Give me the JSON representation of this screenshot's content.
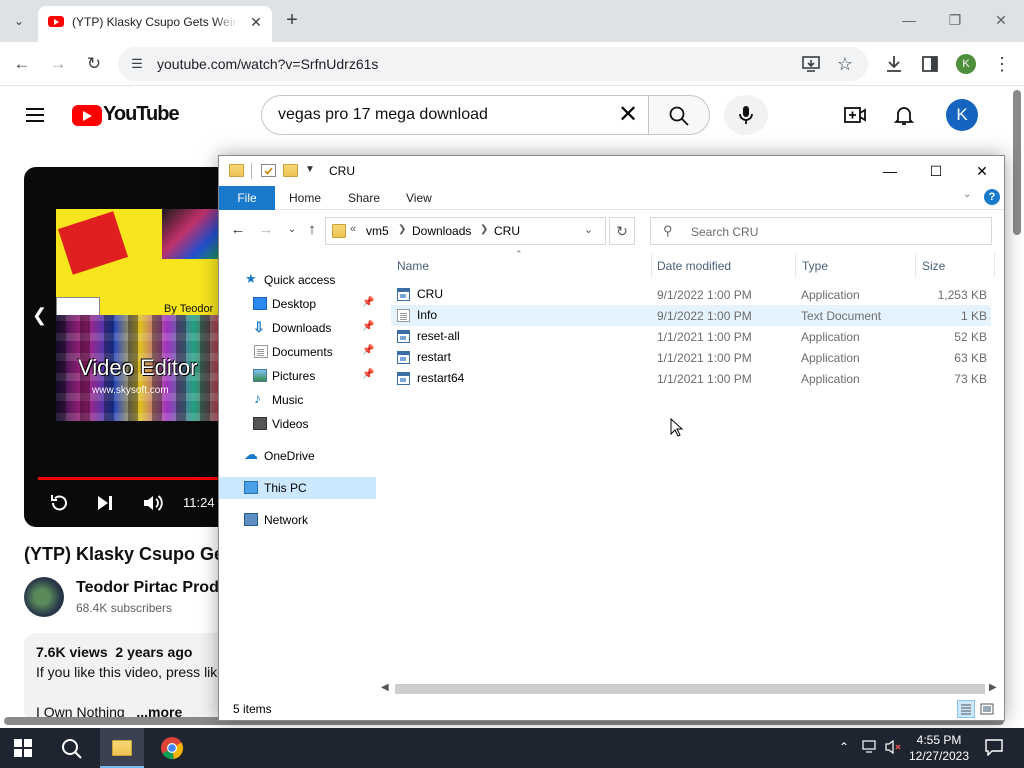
{
  "browser": {
    "tab_title": "(YTP) Klasky Csupo Gets Weirder",
    "url": "youtube.com/watch?v=SrfnUdrz61s"
  },
  "youtube": {
    "search_query": "vegas pro 17 mega download",
    "avatar_letter": "K",
    "video_time": "11:24",
    "video_title": "(YTP) Klasky Csupo Gets Weirder",
    "channel_name": "Teodor Pirtac Productions",
    "subscribers": "68.4K subscribers",
    "views": "7.6K views",
    "age": "2 years ago",
    "description": "If you like this video, press like",
    "description_line2": "I Own Nothing",
    "more_label": "...more",
    "thumb_text_top": "By Teodor",
    "thumb_text_main": "Video Editor",
    "thumb_text_site": "www.skysoft.com"
  },
  "explorer": {
    "title": "CRU",
    "ribbon": {
      "file": "File",
      "home": "Home",
      "share": "Share",
      "view": "View"
    },
    "breadcrumb": [
      "vm5",
      "Downloads",
      "CRU"
    ],
    "search_placeholder": "Search CRU",
    "nav": {
      "quick_access": "Quick access",
      "desktop": "Desktop",
      "downloads": "Downloads",
      "documents": "Documents",
      "pictures": "Pictures",
      "music": "Music",
      "videos": "Videos",
      "onedrive": "OneDrive",
      "this_pc": "This PC",
      "network": "Network"
    },
    "columns": {
      "name": "Name",
      "date": "Date modified",
      "type": "Type",
      "size": "Size"
    },
    "files": [
      {
        "name": "CRU",
        "date": "9/1/2022 1:00 PM",
        "type": "Application",
        "size": "1,253 KB",
        "icon": "application-icon"
      },
      {
        "name": "Info",
        "date": "9/1/2022 1:00 PM",
        "type": "Text Document",
        "size": "1 KB",
        "icon": "text-document-icon"
      },
      {
        "name": "reset-all",
        "date": "1/1/2021 1:00 PM",
        "type": "Application",
        "size": "52 KB",
        "icon": "application-icon"
      },
      {
        "name": "restart",
        "date": "1/1/2021 1:00 PM",
        "type": "Application",
        "size": "63 KB",
        "icon": "application-icon"
      },
      {
        "name": "restart64",
        "date": "1/1/2021 1:00 PM",
        "type": "Application",
        "size": "73 KB",
        "icon": "application-icon"
      }
    ],
    "status": "5 items"
  },
  "taskbar": {
    "time": "4:55 PM",
    "date": "12/27/2023"
  },
  "colors": {
    "youtube_red": "#ff0000",
    "explorer_accent": "#1979ca",
    "selection": "#cce8ff",
    "taskbar": "#1f2530"
  }
}
